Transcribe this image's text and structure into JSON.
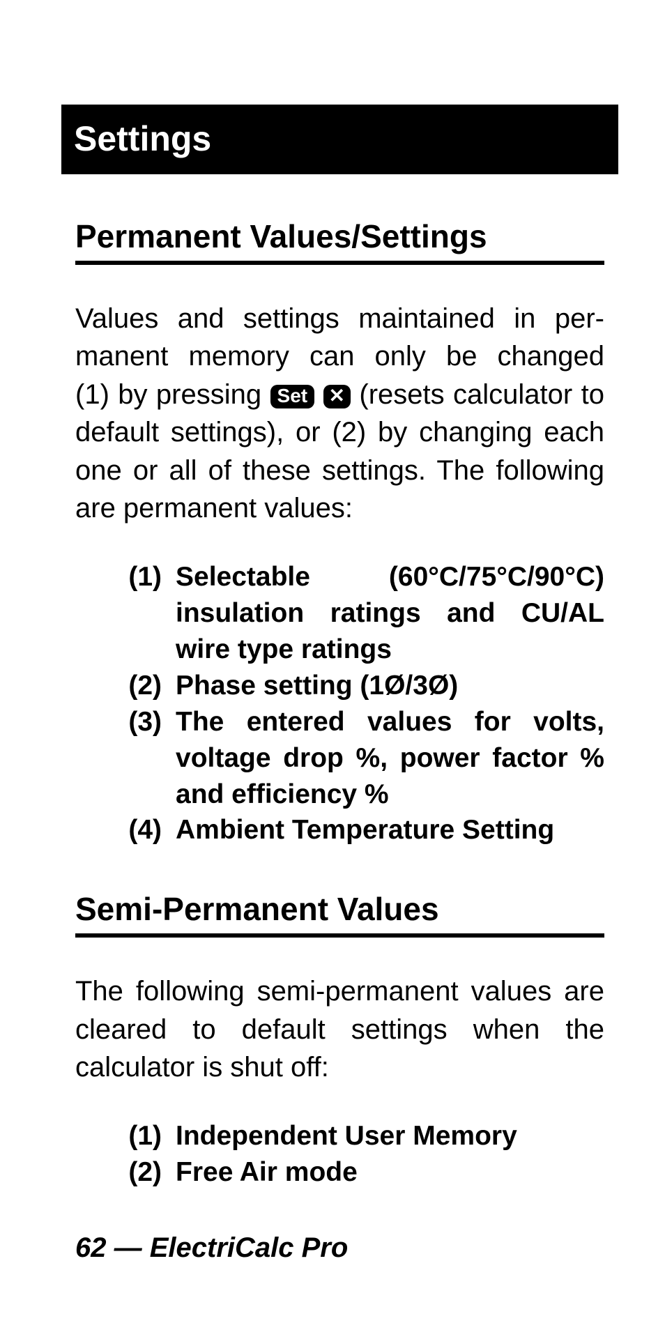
{
  "title": "Settings",
  "section1": {
    "heading": "Permanent Values/Settings",
    "para_before": "Values and settings maintained in per­manent memory can only be changed (1) by pressing",
    "key_set": "Set",
    "key_x": "✕",
    "para_after": "(resets calculator to default settings), or (2) by changing each one or all of these settings. The following are permanent values:",
    "items": [
      "Selectable (60°C/75°C/90°C) insula­tion ratings and CU/AL wire type rat­ings",
      "Phase setting (1Ø/3Ø)",
      "The entered values for volts, volt­age drop %, power factor % and efficiency %",
      "Ambient Temperature Setting"
    ]
  },
  "section2": {
    "heading": "Semi-Permanent Values",
    "para": "The following semi-permanent values are cleared to default settings when the calculator is shut off:",
    "items": [
      "Independent User Memory",
      "Free Air mode"
    ]
  },
  "footer": "62 — ElectriCalc Pro"
}
